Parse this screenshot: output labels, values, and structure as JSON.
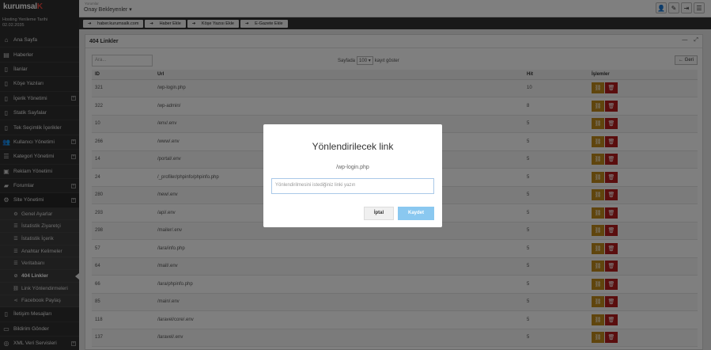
{
  "logo": {
    "main": "kurumsal",
    "accent": "K"
  },
  "hosting": {
    "label": "Hosting Yenileme Tarihi",
    "date": "02.02.2035"
  },
  "sidebar": {
    "items": [
      {
        "label": "Ana Sayfa",
        "icon": "home-icon",
        "glyph": "⌂",
        "plus": false
      },
      {
        "label": "Haberler",
        "icon": "newspaper-icon",
        "glyph": "▤",
        "plus": false
      },
      {
        "label": "İlanlar",
        "icon": "document-icon",
        "glyph": "▯",
        "plus": false
      },
      {
        "label": "Köşe Yazıları",
        "icon": "document-icon",
        "glyph": "▯",
        "plus": false
      },
      {
        "label": "İçerik Yönetimi",
        "icon": "document-icon",
        "glyph": "▯",
        "plus": true
      },
      {
        "label": "Statik Sayfalar",
        "icon": "document-icon",
        "glyph": "▯",
        "plus": false
      },
      {
        "label": "Tek Seçimlik İçerikler",
        "icon": "document-icon",
        "glyph": "▯",
        "plus": false
      },
      {
        "label": "Kullanıcı Yönetimi",
        "icon": "users-icon",
        "glyph": "👥",
        "plus": true
      },
      {
        "label": "Kategori Yönetimi",
        "icon": "list-icon",
        "glyph": "☰",
        "plus": true
      },
      {
        "label": "Reklam Yönetimi",
        "icon": "image-icon",
        "glyph": "▣",
        "plus": false
      },
      {
        "label": "Forumlar",
        "icon": "folder-icon",
        "glyph": "▰",
        "plus": true
      },
      {
        "label": "Site Yönetimi",
        "icon": "gear-icon",
        "glyph": "⚙",
        "plus": true
      }
    ],
    "sub_items": [
      {
        "label": "Genel Ayarlar",
        "icon": "gear-icon",
        "glyph": "⚙"
      },
      {
        "label": "İstatistik Ziyaretçi",
        "icon": "bars-icon",
        "glyph": "☰"
      },
      {
        "label": "İstatistik İçerik",
        "icon": "bars-icon",
        "glyph": "☰"
      },
      {
        "label": "Anahtar Kelimeler",
        "icon": "bars-icon",
        "glyph": "☰"
      },
      {
        "label": "Veritabanı",
        "icon": "bars-icon",
        "glyph": "☰"
      },
      {
        "label": "404 Linkler",
        "icon": "ban-icon",
        "glyph": "⊘"
      },
      {
        "label": "Link Yönlendirmeleri",
        "icon": "link-icon",
        "glyph": "⛓"
      },
      {
        "label": "Facebook Paylaş",
        "icon": "share-icon",
        "glyph": "⋖"
      }
    ],
    "bottom_items": [
      {
        "label": "İletişim Mesajları",
        "icon": "document-icon",
        "glyph": "▯",
        "plus": false
      },
      {
        "label": "Bildirim Gönder",
        "icon": "monitor-icon",
        "glyph": "▭",
        "plus": false
      },
      {
        "label": "XML Veri Servisleri",
        "icon": "globe-icon",
        "glyph": "◎",
        "plus": true
      }
    ]
  },
  "topbar": {
    "small": "Yorumlar",
    "dropdown": "Onay Bekleyenler"
  },
  "linkbar": [
    "haber.kurumsalk.com",
    "Haber Ekle",
    "Köşe Yazısı Ekle",
    "E-Gazete Ekle"
  ],
  "panel": {
    "title": "404 Linkler",
    "search_placeholder": "Ara...",
    "pager_before": "Sayfada",
    "pager_value": "100",
    "pager_after": "kayıt göster",
    "back_label": "Geri"
  },
  "table": {
    "headers": [
      "ID",
      "Url",
      "Hit",
      "İşlemler"
    ],
    "rows": [
      {
        "id": "321",
        "url": "/wp-login.php",
        "hit": "10"
      },
      {
        "id": "322",
        "url": "/wp-admin/",
        "hit": "8"
      },
      {
        "id": "10",
        "url": "/env/.env",
        "hit": "5"
      },
      {
        "id": "266",
        "url": "/www/.env",
        "hit": "5"
      },
      {
        "id": "14",
        "url": "/portal/.env",
        "hit": "5"
      },
      {
        "id": "24",
        "url": "/_profiler/phpinfo/phpinfo.php",
        "hit": "5"
      },
      {
        "id": "280",
        "url": "/new/.env",
        "hit": "5"
      },
      {
        "id": "293",
        "url": "/api/.env",
        "hit": "5"
      },
      {
        "id": "298",
        "url": "/mailer/.env",
        "hit": "5"
      },
      {
        "id": "57",
        "url": "/lara/info.php",
        "hit": "5"
      },
      {
        "id": "64",
        "url": "/mail/.env",
        "hit": "5"
      },
      {
        "id": "66",
        "url": "/lara/phpinfo.php",
        "hit": "5"
      },
      {
        "id": "85",
        "url": "/main/.env",
        "hit": "5"
      },
      {
        "id": "118",
        "url": "/laravel/core/.env",
        "hit": "5"
      },
      {
        "id": "137",
        "url": "/laravel/.env",
        "hit": "5"
      }
    ]
  },
  "modal": {
    "title": "Yönlendirilecek link",
    "path": "/wp-login.php",
    "input_placeholder": "Yönlendirilmesini istediğiniz linki yazın",
    "cancel_label": "İptal",
    "save_label": "Kaydet"
  }
}
